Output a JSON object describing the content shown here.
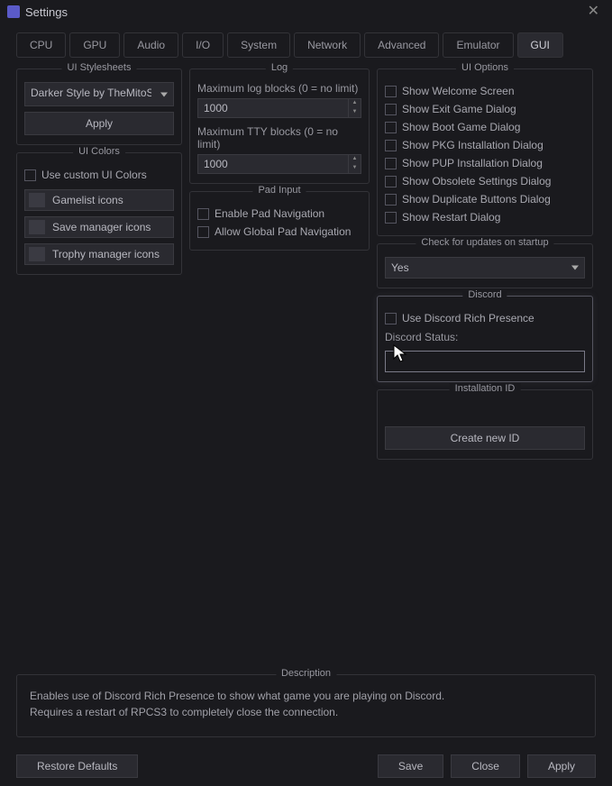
{
  "window": {
    "title": "Settings"
  },
  "tabs": [
    "CPU",
    "GPU",
    "Audio",
    "I/O",
    "System",
    "Network",
    "Advanced",
    "Emulator",
    "GUI"
  ],
  "active_tab": "GUI",
  "stylesheets": {
    "title": "UI Stylesheets",
    "selected": "Darker Style by TheMitoSan",
    "apply": "Apply"
  },
  "colors": {
    "title": "UI Colors",
    "use_custom": "Use custom UI Colors",
    "buttons": [
      "Gamelist icons",
      "Save manager icons",
      "Trophy manager icons"
    ]
  },
  "log": {
    "title": "Log",
    "max_log_label": "Maximum log blocks (0 = no limit)",
    "max_log_value": "1000",
    "max_tty_label": "Maximum TTY blocks (0 = no limit)",
    "max_tty_value": "1000"
  },
  "pad": {
    "title": "Pad Input",
    "enable": "Enable Pad Navigation",
    "allow_global": "Allow Global Pad Navigation"
  },
  "uiopts": {
    "title": "UI Options",
    "items": [
      "Show Welcome Screen",
      "Show Exit Game Dialog",
      "Show Boot Game Dialog",
      "Show PKG Installation Dialog",
      "Show PUP Installation Dialog",
      "Show Obsolete Settings Dialog",
      "Show Duplicate Buttons Dialog",
      "Show Restart Dialog"
    ]
  },
  "updates": {
    "title": "Check for updates on startup",
    "value": "Yes"
  },
  "discord": {
    "title": "Discord",
    "use_rp": "Use Discord Rich Presence",
    "status_label": "Discord Status:",
    "status_value": ""
  },
  "install": {
    "title": "Installation ID",
    "create": "Create new ID"
  },
  "description": {
    "title": "Description",
    "text": "Enables use of Discord Rich Presence to show what game you are playing on Discord.\nRequires a restart of RPCS3 to completely close the connection."
  },
  "buttons": {
    "restore": "Restore Defaults",
    "save": "Save",
    "close": "Close",
    "apply": "Apply"
  }
}
